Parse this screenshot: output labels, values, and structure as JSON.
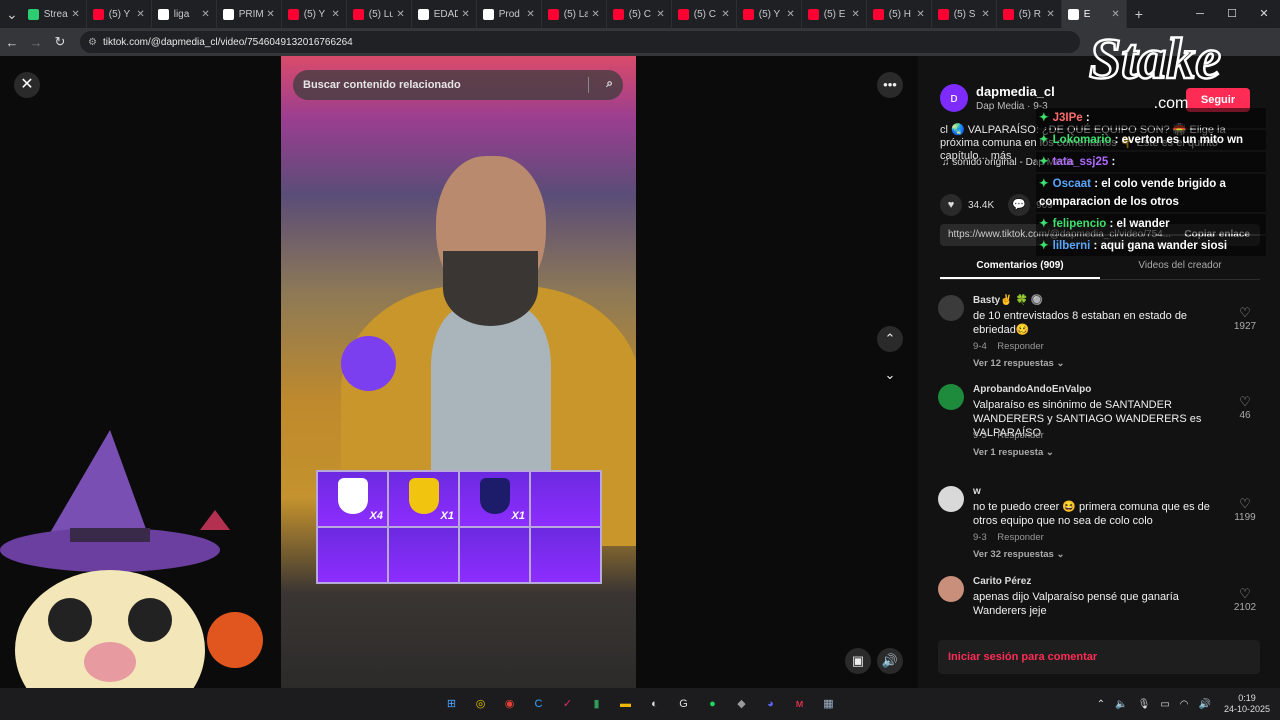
{
  "browser": {
    "tabs": [
      {
        "label": "Strea",
        "color": "#2ecc71"
      },
      {
        "label": "(5) Y",
        "color": "#ff0033"
      },
      {
        "label": "liga",
        "color": "#ffffff"
      },
      {
        "label": "PRIM",
        "color": "#ffffff"
      },
      {
        "label": "(5) Y",
        "color": "#ff0033"
      },
      {
        "label": "(5) Lu",
        "color": "#ff0033"
      },
      {
        "label": "EDAD",
        "color": "#ffffff"
      },
      {
        "label": "Prod",
        "color": "#ffffff"
      },
      {
        "label": "(5) La",
        "color": "#ff0033"
      },
      {
        "label": "(5) C",
        "color": "#ff0033"
      },
      {
        "label": "(5) C",
        "color": "#ff0033"
      },
      {
        "label": "(5) Y",
        "color": "#ff0033"
      },
      {
        "label": "(5) E",
        "color": "#ff0033"
      },
      {
        "label": "(5) H",
        "color": "#ff0033"
      },
      {
        "label": "(5) S",
        "color": "#ff0033"
      },
      {
        "label": "(5) R",
        "color": "#ff0033"
      },
      {
        "label": "E",
        "color": "#ffffff",
        "active": true
      }
    ],
    "new_tab": "+",
    "url": "tiktok.com/@dapmedia_cl/video/7546049132016766264"
  },
  "video": {
    "search_placeholder": "Buscar contenido relacionado",
    "grid": [
      {
        "mult": "X4",
        "color": "#ffffff"
      },
      {
        "mult": "X1",
        "color": "#f1c40f"
      },
      {
        "mult": "X1",
        "color": "#1c1c6b"
      },
      {
        "mult": "",
        "color": ""
      }
    ]
  },
  "panel": {
    "creator_handle": "dapmedia_cl",
    "creator_sub": "Dap Media · 9-3",
    "follow_label": "Seguir",
    "description": "cl 🌏 VALPARAÍSO: ¿DE QUÉ EQUIPO SON? 🏟️ Elige la próxima comuna en los comentarios 👇 Este es el quinto capítulo... más",
    "music": "♫  sonido original - Dap Media",
    "likes": "34.4K",
    "comments_count": "909",
    "link": "https://www.tiktok.com/@dapmedia_cl/video/754...",
    "copy_label": "Copiar enlace",
    "tab_comments": "Comentarios (909)",
    "tab_videos": "Videos del creador",
    "comments": [
      {
        "user": "Basty✌️ 🍀 🔘",
        "text": "de 10 entrevistados 8 estaban en estado de ebriedad🥴",
        "date": "9-4",
        "reply": "Responder",
        "replies": "Ver 12 respuestas ⌄",
        "likes": "1927",
        "avatar": "#3b3b3b"
      },
      {
        "user": "AprobandoAndoEnValpo",
        "text": "Valparaíso es sinónimo de SANTANDER WANDERERS y SANTIAGO WANDERERS es VALPARAÍSO",
        "date": "9-3",
        "reply": "Responder",
        "replies": "Ver 1 respuesta ⌄",
        "likes": "46",
        "avatar": "#1e8a3c"
      },
      {
        "user": "w",
        "text": "no te puedo creer 😆 primera comuna que es de otros equipo que no sea de colo colo",
        "date": "9-3",
        "reply": "Responder",
        "replies": "Ver 32 respuestas ⌄",
        "likes": "1199",
        "avatar": "#d9d9d9"
      },
      {
        "user": "Carito Pérez",
        "text": "apenas dijo Valparaíso pensé que ganaría Wanderers jeje",
        "date": "",
        "reply": "",
        "replies": "",
        "likes": "2102",
        "avatar": "#c98f7a"
      }
    ],
    "login_label": "Iniciar sesión para comentar"
  },
  "chat": [
    {
      "user": "J3IPe",
      "user_color": "#ff6b6b",
      "msg": ":"
    },
    {
      "user": "Lokomario",
      "user_color": "#3ee06d",
      "msg": ": everton es un mito wn"
    },
    {
      "user": "tata_ssj25",
      "user_color": "#b069ff",
      "msg": ":"
    },
    {
      "user": "Oscaat",
      "user_color": "#58a6ff",
      "msg": ": el colo vende brigido a comparacion de los otros"
    },
    {
      "user": "felipencio",
      "user_color": "#3ee06d",
      "msg": ": el wander"
    },
    {
      "user": "lilberni",
      "user_color": "#58a6ff",
      "msg": ": aqui gana wander siosi"
    }
  ],
  "stake_logo": {
    "text": "Stake",
    "suffix": ".com"
  },
  "taskbar": {
    "time": "0:19",
    "date": "24-10-2025",
    "apps": [
      {
        "name": "start-icon",
        "glyph": "⊞",
        "color": "#4aa3ff"
      },
      {
        "name": "app-icon",
        "glyph": "◎",
        "color": "#e6c200"
      },
      {
        "name": "chrome-icon",
        "glyph": "◉",
        "color": "#e34133"
      },
      {
        "name": "c-icon",
        "glyph": "C",
        "color": "#3aa0ff"
      },
      {
        "name": "app2-icon",
        "glyph": "✓",
        "color": "#e03060"
      },
      {
        "name": "file-icon",
        "glyph": "▮",
        "color": "#2e9c5a"
      },
      {
        "name": "folder-icon",
        "glyph": "▬",
        "color": "#f2b705"
      },
      {
        "name": "obs-icon",
        "glyph": "◐",
        "color": "#dddddd"
      },
      {
        "name": "g-icon",
        "glyph": "G",
        "color": "#dddddd"
      },
      {
        "name": "spotify-icon",
        "glyph": "●",
        "color": "#1ed760"
      },
      {
        "name": "app3-icon",
        "glyph": "◆",
        "color": "#999999"
      },
      {
        "name": "discord-icon",
        "glyph": "◕",
        "color": "#5865f2"
      },
      {
        "name": "app4-icon",
        "glyph": "ᴍ",
        "color": "#ff3355"
      },
      {
        "name": "calc-icon",
        "glyph": "▦",
        "color": "#9fb3c8"
      }
    ]
  }
}
